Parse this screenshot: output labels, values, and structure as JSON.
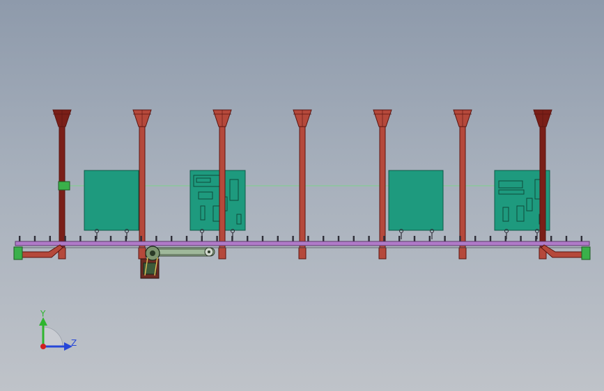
{
  "viewport": {
    "background_top": "#8e9aab",
    "background_bottom": "#bfc3c9"
  },
  "model": {
    "colors": {
      "post": "#b5493b",
      "post_dark": "#7a1f18",
      "post_edge": "#5a1410",
      "rail": "#b07ac8",
      "rail_edge": "#5e3a6e",
      "panel": "#1e9a7e",
      "panel_edge": "#0f5a48",
      "sensor": "#3ab04a",
      "motor": "#3d5a3a",
      "conveyor": "#6c8a5e"
    },
    "post_count": 7,
    "panel_count": 4
  },
  "triad": {
    "y_label": "Y",
    "z_label": "Z",
    "y_color": "#2fb52f",
    "z_color": "#2747d8",
    "x_color": "#d02020"
  }
}
